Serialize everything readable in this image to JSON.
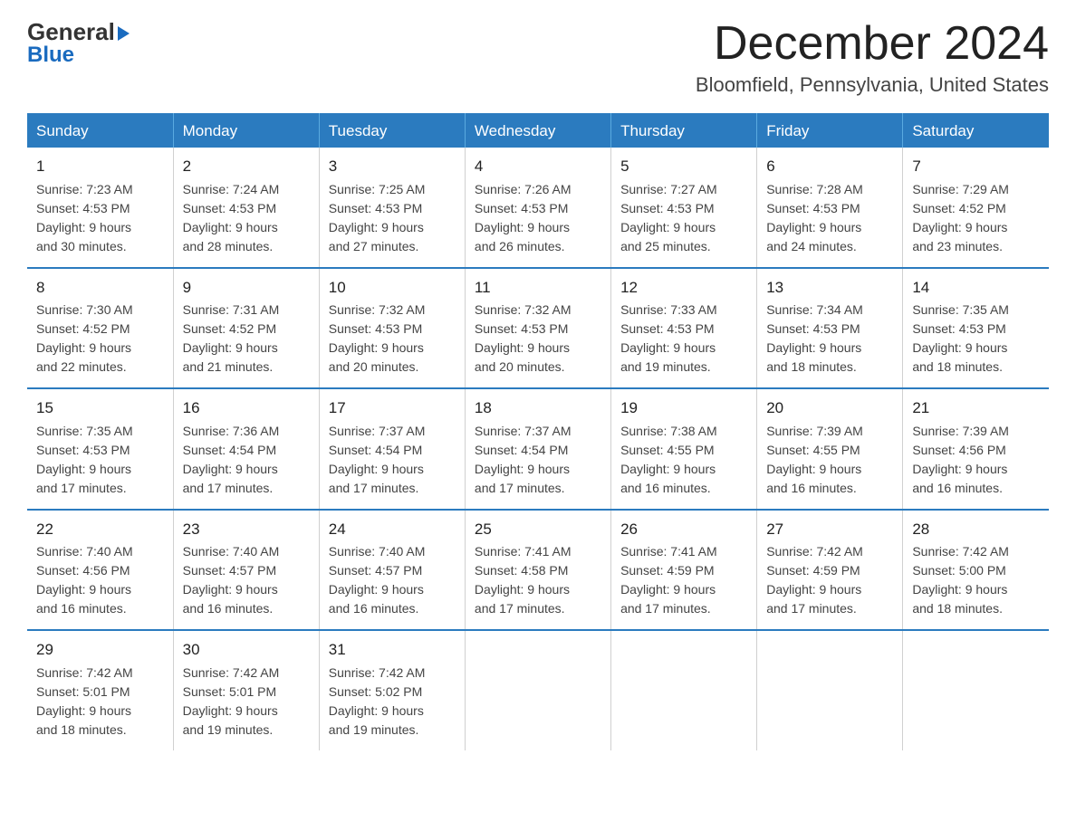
{
  "logo": {
    "line1": "General",
    "arrow": "▶",
    "line2": "Blue"
  },
  "title": "December 2024",
  "subtitle": "Bloomfield, Pennsylvania, United States",
  "days_of_week": [
    "Sunday",
    "Monday",
    "Tuesday",
    "Wednesday",
    "Thursday",
    "Friday",
    "Saturday"
  ],
  "weeks": [
    [
      {
        "num": "1",
        "info": "Sunrise: 7:23 AM\nSunset: 4:53 PM\nDaylight: 9 hours\nand 30 minutes."
      },
      {
        "num": "2",
        "info": "Sunrise: 7:24 AM\nSunset: 4:53 PM\nDaylight: 9 hours\nand 28 minutes."
      },
      {
        "num": "3",
        "info": "Sunrise: 7:25 AM\nSunset: 4:53 PM\nDaylight: 9 hours\nand 27 minutes."
      },
      {
        "num": "4",
        "info": "Sunrise: 7:26 AM\nSunset: 4:53 PM\nDaylight: 9 hours\nand 26 minutes."
      },
      {
        "num": "5",
        "info": "Sunrise: 7:27 AM\nSunset: 4:53 PM\nDaylight: 9 hours\nand 25 minutes."
      },
      {
        "num": "6",
        "info": "Sunrise: 7:28 AM\nSunset: 4:53 PM\nDaylight: 9 hours\nand 24 minutes."
      },
      {
        "num": "7",
        "info": "Sunrise: 7:29 AM\nSunset: 4:52 PM\nDaylight: 9 hours\nand 23 minutes."
      }
    ],
    [
      {
        "num": "8",
        "info": "Sunrise: 7:30 AM\nSunset: 4:52 PM\nDaylight: 9 hours\nand 22 minutes."
      },
      {
        "num": "9",
        "info": "Sunrise: 7:31 AM\nSunset: 4:52 PM\nDaylight: 9 hours\nand 21 minutes."
      },
      {
        "num": "10",
        "info": "Sunrise: 7:32 AM\nSunset: 4:53 PM\nDaylight: 9 hours\nand 20 minutes."
      },
      {
        "num": "11",
        "info": "Sunrise: 7:32 AM\nSunset: 4:53 PM\nDaylight: 9 hours\nand 20 minutes."
      },
      {
        "num": "12",
        "info": "Sunrise: 7:33 AM\nSunset: 4:53 PM\nDaylight: 9 hours\nand 19 minutes."
      },
      {
        "num": "13",
        "info": "Sunrise: 7:34 AM\nSunset: 4:53 PM\nDaylight: 9 hours\nand 18 minutes."
      },
      {
        "num": "14",
        "info": "Sunrise: 7:35 AM\nSunset: 4:53 PM\nDaylight: 9 hours\nand 18 minutes."
      }
    ],
    [
      {
        "num": "15",
        "info": "Sunrise: 7:35 AM\nSunset: 4:53 PM\nDaylight: 9 hours\nand 17 minutes."
      },
      {
        "num": "16",
        "info": "Sunrise: 7:36 AM\nSunset: 4:54 PM\nDaylight: 9 hours\nand 17 minutes."
      },
      {
        "num": "17",
        "info": "Sunrise: 7:37 AM\nSunset: 4:54 PM\nDaylight: 9 hours\nand 17 minutes."
      },
      {
        "num": "18",
        "info": "Sunrise: 7:37 AM\nSunset: 4:54 PM\nDaylight: 9 hours\nand 17 minutes."
      },
      {
        "num": "19",
        "info": "Sunrise: 7:38 AM\nSunset: 4:55 PM\nDaylight: 9 hours\nand 16 minutes."
      },
      {
        "num": "20",
        "info": "Sunrise: 7:39 AM\nSunset: 4:55 PM\nDaylight: 9 hours\nand 16 minutes."
      },
      {
        "num": "21",
        "info": "Sunrise: 7:39 AM\nSunset: 4:56 PM\nDaylight: 9 hours\nand 16 minutes."
      }
    ],
    [
      {
        "num": "22",
        "info": "Sunrise: 7:40 AM\nSunset: 4:56 PM\nDaylight: 9 hours\nand 16 minutes."
      },
      {
        "num": "23",
        "info": "Sunrise: 7:40 AM\nSunset: 4:57 PM\nDaylight: 9 hours\nand 16 minutes."
      },
      {
        "num": "24",
        "info": "Sunrise: 7:40 AM\nSunset: 4:57 PM\nDaylight: 9 hours\nand 16 minutes."
      },
      {
        "num": "25",
        "info": "Sunrise: 7:41 AM\nSunset: 4:58 PM\nDaylight: 9 hours\nand 17 minutes."
      },
      {
        "num": "26",
        "info": "Sunrise: 7:41 AM\nSunset: 4:59 PM\nDaylight: 9 hours\nand 17 minutes."
      },
      {
        "num": "27",
        "info": "Sunrise: 7:42 AM\nSunset: 4:59 PM\nDaylight: 9 hours\nand 17 minutes."
      },
      {
        "num": "28",
        "info": "Sunrise: 7:42 AM\nSunset: 5:00 PM\nDaylight: 9 hours\nand 18 minutes."
      }
    ],
    [
      {
        "num": "29",
        "info": "Sunrise: 7:42 AM\nSunset: 5:01 PM\nDaylight: 9 hours\nand 18 minutes."
      },
      {
        "num": "30",
        "info": "Sunrise: 7:42 AM\nSunset: 5:01 PM\nDaylight: 9 hours\nand 19 minutes."
      },
      {
        "num": "31",
        "info": "Sunrise: 7:42 AM\nSunset: 5:02 PM\nDaylight: 9 hours\nand 19 minutes."
      },
      null,
      null,
      null,
      null
    ]
  ]
}
